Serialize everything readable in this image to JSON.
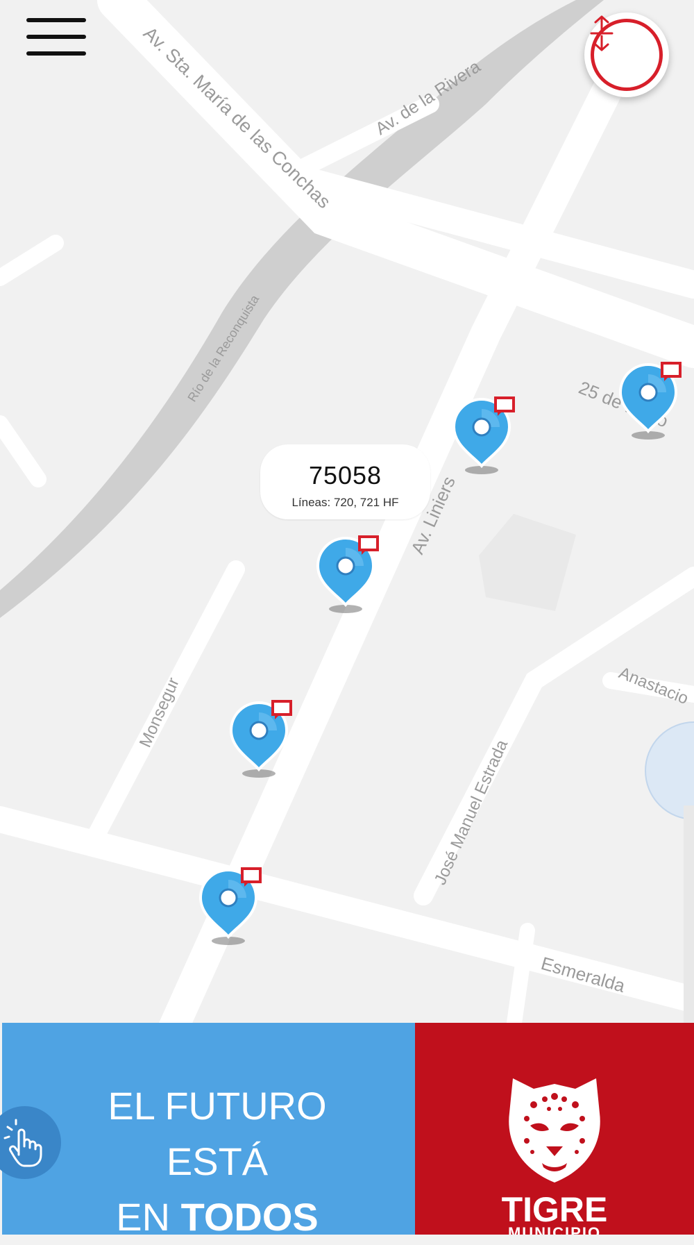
{
  "map": {
    "streets": {
      "santa_maria": "Av. Sta. María de las Conchas",
      "de_la_rivera": "Av. de la Rivera",
      "reconquista": "Río de la Reconquista",
      "liniers": "Av. Liniers",
      "mayo": "25 de Mayo",
      "monsegur": "Monsegur",
      "estrada": "José Manuel Estrada",
      "anastacio": "Anastacio",
      "esmeralda": "Esmeralda"
    },
    "selected_stop": {
      "number": "75058",
      "lines": "Líneas: 720, 721 HF"
    },
    "stops_count": 5
  },
  "icons": {
    "menu": "hamburger-menu-icon",
    "toggle": "expand-collapse-arrows-icon",
    "stop": "bus-stop-pin-icon",
    "touch": "hand-touch-icon",
    "logo": "jaguar-logo"
  },
  "banner": {
    "line1": "EL FUTURO",
    "line2": "ESTÁ",
    "line3_light": "EN ",
    "line3_bold": "TODOS",
    "brand": "TIGRE",
    "brand_sub": "MUNICIPIO"
  },
  "colors": {
    "accent_red": "#d71f2a",
    "pin_blue": "#3fa9e8",
    "banner_blue": "#4fa3e3",
    "banner_red": "#c0101c"
  }
}
